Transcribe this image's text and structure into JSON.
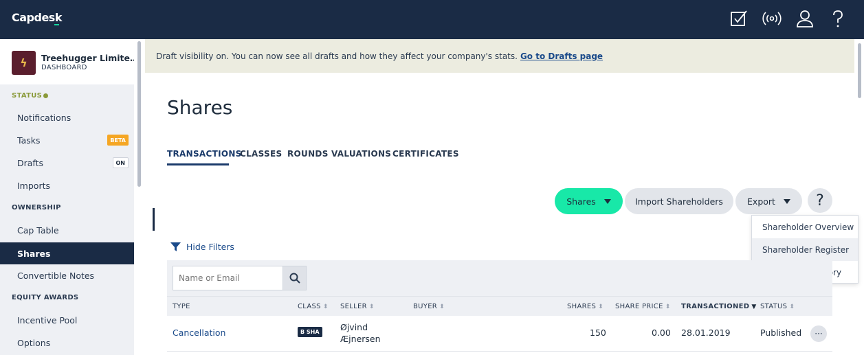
{
  "app": {
    "logo": "Capdesk"
  },
  "header_icons": [
    "checkbox-icon",
    "broadcast-icon",
    "user-icon",
    "help-icon"
  ],
  "sidebar": {
    "company_name": "Treehugger Limite…",
    "company_sub": "DASHBOARD",
    "status_label": "STATUS",
    "status_items": [
      {
        "label": "Notifications"
      },
      {
        "label": "Tasks",
        "badge": "BETA"
      },
      {
        "label": "Drafts",
        "badge": "ON"
      },
      {
        "label": "Imports"
      }
    ],
    "ownership_label": "OWNERSHIP",
    "ownership_items": [
      {
        "label": "Cap Table"
      },
      {
        "label": "Shares",
        "active": true
      },
      {
        "label": "Convertible Notes"
      }
    ],
    "equity_label": "EQUITY AWARDS",
    "equity_items": [
      {
        "label": "Incentive Pool"
      },
      {
        "label": "Options"
      }
    ]
  },
  "banner": {
    "text": "Draft visibility on. You can now see all drafts and how they affect your company's stats.",
    "link": "Go to Drafts page"
  },
  "page": {
    "title": "Shares",
    "tabs": [
      "TRANSACTIONS",
      "CLASSES",
      "ROUNDS",
      "VALUATIONS",
      "CERTIFICATES"
    ],
    "active_tab": "TRANSACTIONS"
  },
  "actions": {
    "shares_button": "Shares",
    "import_button": "Import Shareholders",
    "export_button": "Export",
    "help_button": "?"
  },
  "export_menu": [
    "Shareholder Overview",
    "Shareholder Register",
    "Transaction History"
  ],
  "filters": {
    "toggle_label": "Hide Filters",
    "search_placeholder": "Name or Email"
  },
  "table": {
    "columns": [
      "TYPE",
      "CLASS",
      "SELLER",
      "BUYER",
      "SHARES",
      "SHARE PRICE",
      "TRANSACTIONED",
      "STATUS"
    ],
    "sorted_column": "TRANSACTIONED",
    "rows": [
      {
        "type": "Cancellation",
        "class": "B SHA",
        "seller_line1": "Øjvind",
        "seller_line2": "Æjnersen",
        "buyer": "",
        "shares": "150",
        "share_price": "0.00",
        "transactioned": "28.01.2019",
        "status": "Published"
      }
    ]
  },
  "colors": {
    "topbar": "#1a2b45",
    "accent_green": "#18e8a8",
    "link_blue": "#1a4a8a",
    "banner_bg": "#ecece0",
    "beta_badge": "#f5a623"
  }
}
